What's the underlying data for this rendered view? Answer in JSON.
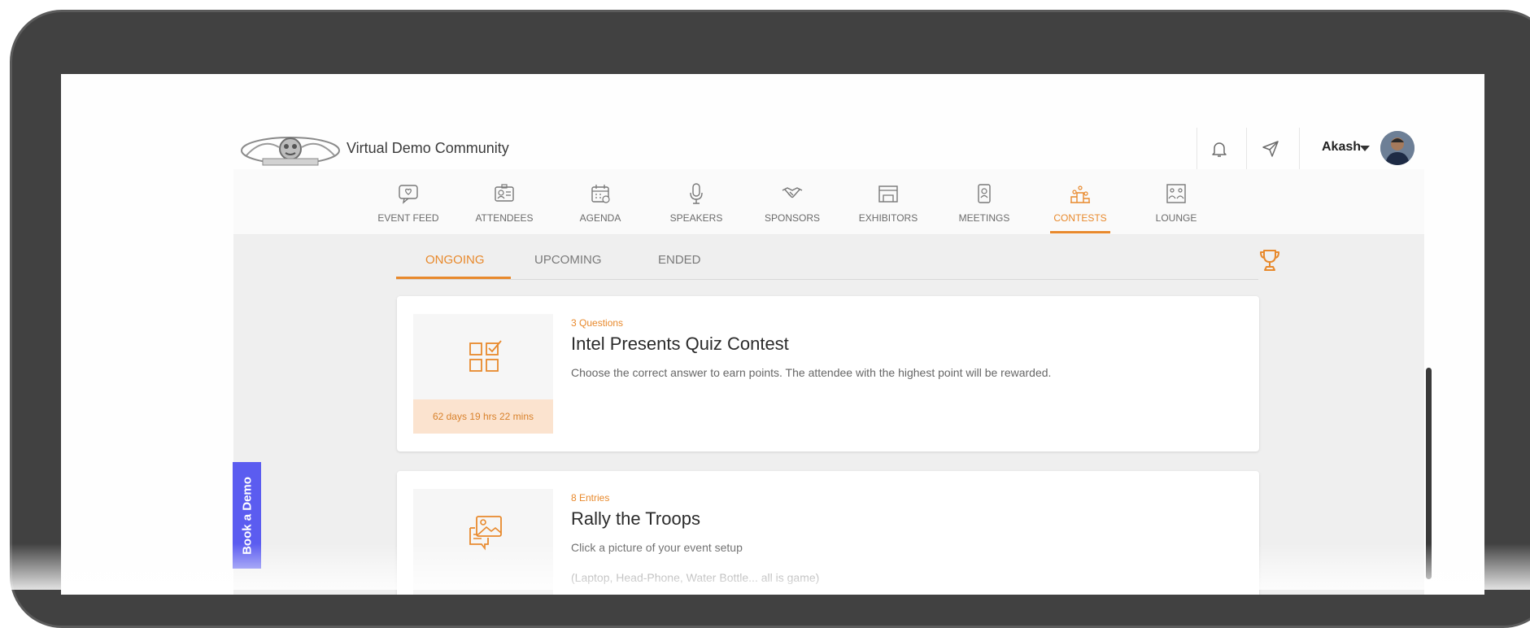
{
  "header": {
    "community_name": "Virtual Demo Community",
    "user_name": "Akash",
    "icons": [
      "bell-icon",
      "send-icon",
      "chevron-down-icon"
    ]
  },
  "nav": {
    "items": [
      {
        "label": "EVENT FEED",
        "icon": "chat-icon"
      },
      {
        "label": "ATTENDEES",
        "icon": "id-card-icon"
      },
      {
        "label": "AGENDA",
        "icon": "calendar-icon"
      },
      {
        "label": "SPEAKERS",
        "icon": "microphone-icon"
      },
      {
        "label": "SPONSORS",
        "icon": "handshake-icon"
      },
      {
        "label": "EXHIBITORS",
        "icon": "booth-icon"
      },
      {
        "label": "MEETINGS",
        "icon": "meeting-badge-icon"
      },
      {
        "label": "CONTESTS",
        "icon": "podium-icon",
        "active": true
      },
      {
        "label": "LOUNGE",
        "icon": "lounge-icon"
      }
    ]
  },
  "tabs": {
    "items": [
      "ONGOING",
      "UPCOMING",
      "ENDED"
    ],
    "active": "ONGOING",
    "icon": "trophy-icon"
  },
  "contests": [
    {
      "meta": "3 Questions",
      "title": "Intel Presents Quiz Contest",
      "description": "Choose the correct answer to earn points. The attendee with the highest point will be rewarded.",
      "timer": "62 days 19 hrs 22 mins",
      "icon": "quiz-grid-icon"
    },
    {
      "meta": "8 Entries",
      "title": "Rally the Troops",
      "description": "Click a picture of your event setup",
      "description2": "(Laptop, Head-Phone, Water Bottle... all is game)",
      "icon": "photo-chat-icon"
    }
  ],
  "book_demo": {
    "label": "Book a Demo"
  },
  "colors": {
    "accent": "#e8892c",
    "book_demo": "#5b5cf0",
    "device": "#414141"
  }
}
